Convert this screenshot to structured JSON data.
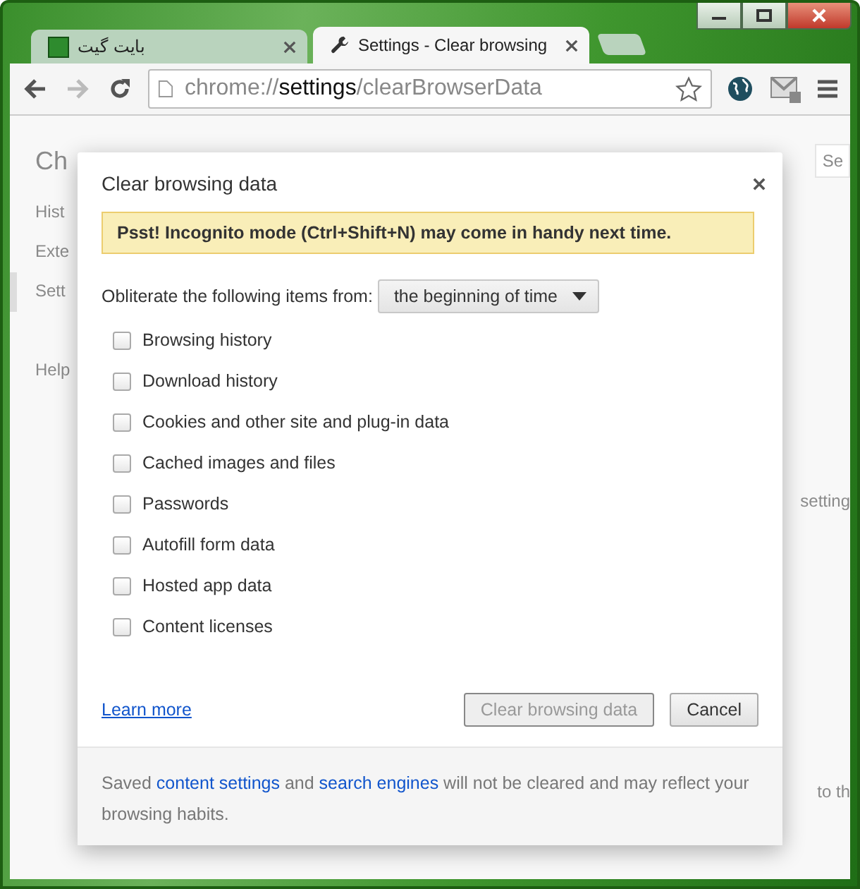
{
  "tabs": [
    {
      "title": "بایت گیت",
      "kind": "site",
      "selected": false
    },
    {
      "title": "Settings - Clear browsing",
      "kind": "settings",
      "selected": true
    }
  ],
  "toolbar": {
    "url_scheme": "chrome://",
    "url_host": "settings",
    "url_path": "/clearBrowserData",
    "bookmarked": false
  },
  "background": {
    "title": "Ch",
    "search_placeholder": "Se",
    "nav": [
      {
        "label": "Hist",
        "selected": false
      },
      {
        "label": "Exte",
        "selected": false
      },
      {
        "label": "Sett",
        "selected": true
      },
      {
        "label": "Help",
        "selected": false
      }
    ],
    "fragments": [
      "setting",
      "to th"
    ]
  },
  "dialog": {
    "title": "Clear browsing data",
    "banner": "Psst! Incognito mode (Ctrl+Shift+N) may come in handy next time.",
    "time_label": "Obliterate the following items from:",
    "time_value": "the beginning of time",
    "items": [
      {
        "label": "Browsing history",
        "checked": false
      },
      {
        "label": "Download history",
        "checked": false
      },
      {
        "label": "Cookies and other site and plug-in data",
        "checked": false
      },
      {
        "label": "Cached images and files",
        "checked": false
      },
      {
        "label": "Passwords",
        "checked": false
      },
      {
        "label": "Autofill form data",
        "checked": false
      },
      {
        "label": "Hosted app data",
        "checked": false
      },
      {
        "label": "Content licenses",
        "checked": false
      }
    ],
    "learn_more": "Learn more",
    "buttons": [
      {
        "label": "Clear browsing data",
        "disabled": true
      },
      {
        "label": "Cancel",
        "disabled": false
      }
    ],
    "footer_note": [
      {
        "text": "Saved ",
        "kind": "text"
      },
      {
        "text": "content settings",
        "kind": "link"
      },
      {
        "text": " and ",
        "kind": "text"
      },
      {
        "text": "search engines",
        "kind": "link"
      },
      {
        "text": " will not be cleared and may reflect your browsing habits.",
        "kind": "text"
      }
    ]
  }
}
